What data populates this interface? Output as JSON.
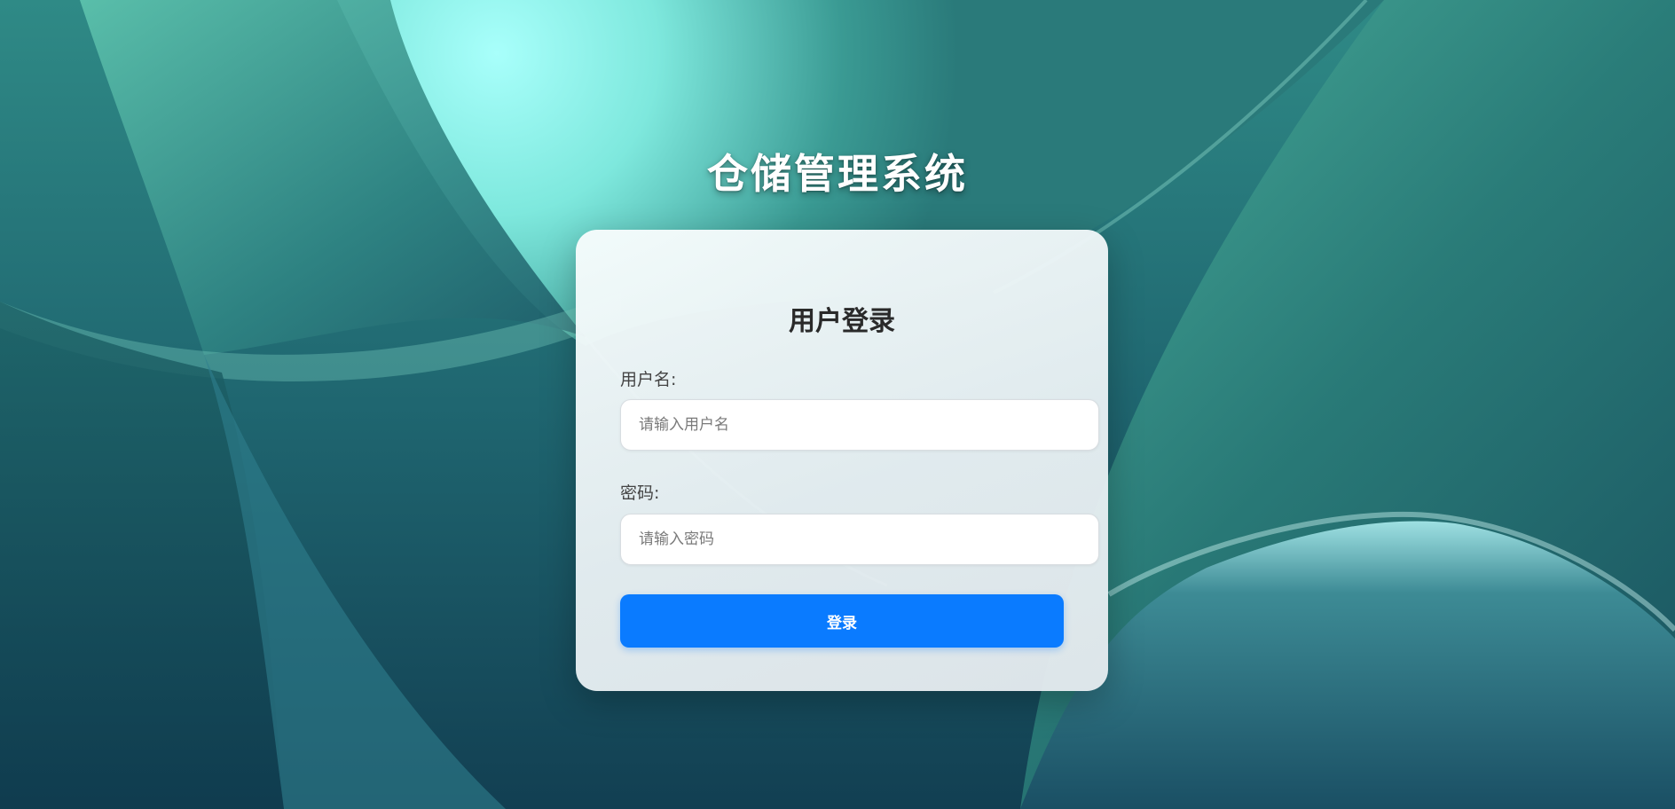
{
  "page": {
    "system_title": "仓储管理系统",
    "colors": {
      "background_dark": "#17505a",
      "background_light": "#a6fff9",
      "accent_button": "#0a7bff"
    }
  },
  "login_form": {
    "title": "用户登录",
    "username_label": "用户名:",
    "username_placeholder": "请输入用户名",
    "username_value": "",
    "password_label": "密码:",
    "password_placeholder": "请输入密码",
    "password_value": "",
    "submit_label": "登录"
  }
}
